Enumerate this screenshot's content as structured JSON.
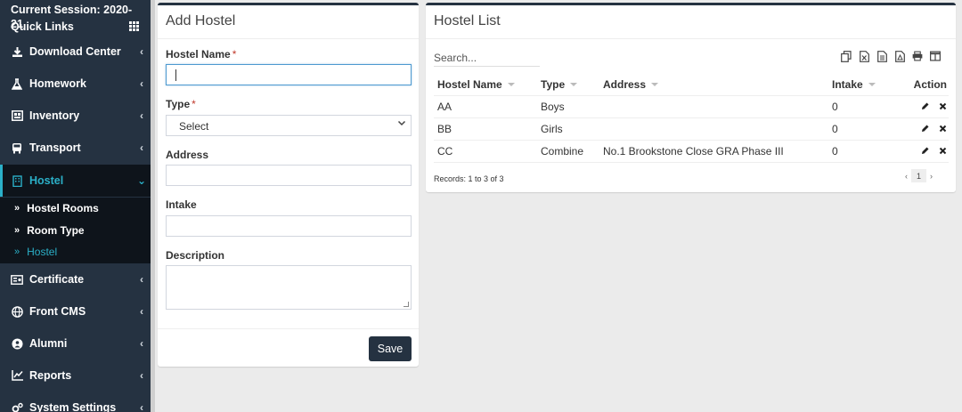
{
  "sidebar": {
    "session": "Current Session: 2020-21",
    "quick_links": "Quick Links",
    "items": [
      {
        "label": "Download Center",
        "icon": "download-icon"
      },
      {
        "label": "Homework",
        "icon": "flask-icon"
      },
      {
        "label": "Inventory",
        "icon": "inventory-icon"
      },
      {
        "label": "Transport",
        "icon": "bus-icon"
      },
      {
        "label": "Hostel",
        "icon": "building-icon"
      },
      {
        "label": "Certificate",
        "icon": "certificate-icon"
      },
      {
        "label": "Front CMS",
        "icon": "globe-icon"
      },
      {
        "label": "Alumni",
        "icon": "user-circle-icon"
      },
      {
        "label": "Reports",
        "icon": "line-chart-icon"
      },
      {
        "label": "System Settings",
        "icon": "gears-icon"
      }
    ],
    "sub_items": [
      {
        "label": "Hostel Rooms"
      },
      {
        "label": "Room Type"
      },
      {
        "label": "Hostel"
      }
    ]
  },
  "add_hostel": {
    "title": "Add Hostel",
    "name_label": "Hostel Name",
    "type_label": "Type",
    "type_value": "Select",
    "address_label": "Address",
    "intake_label": "Intake",
    "description_label": "Description",
    "required_mark": "*",
    "save_label": "Save"
  },
  "hostel_list": {
    "title": "Hostel List",
    "search_placeholder": "Search...",
    "columns": [
      "Hostel Name",
      "Type",
      "Address",
      "Intake",
      "Action"
    ],
    "rows": [
      {
        "name": "AA",
        "type": "Boys",
        "address": "",
        "intake": "0"
      },
      {
        "name": "BB",
        "type": "Girls",
        "address": "",
        "intake": "0"
      },
      {
        "name": "CC",
        "type": "Combine",
        "address": "No.1 Brookstone Close GRA Phase III",
        "intake": "0"
      }
    ],
    "records": "Records: 1 to 3 of 3",
    "page": "1",
    "prev": "‹",
    "next": "›"
  },
  "colors": {
    "sidebar_bg": "#253241",
    "accent": "#2bb0c8",
    "button_bg": "#253241"
  }
}
